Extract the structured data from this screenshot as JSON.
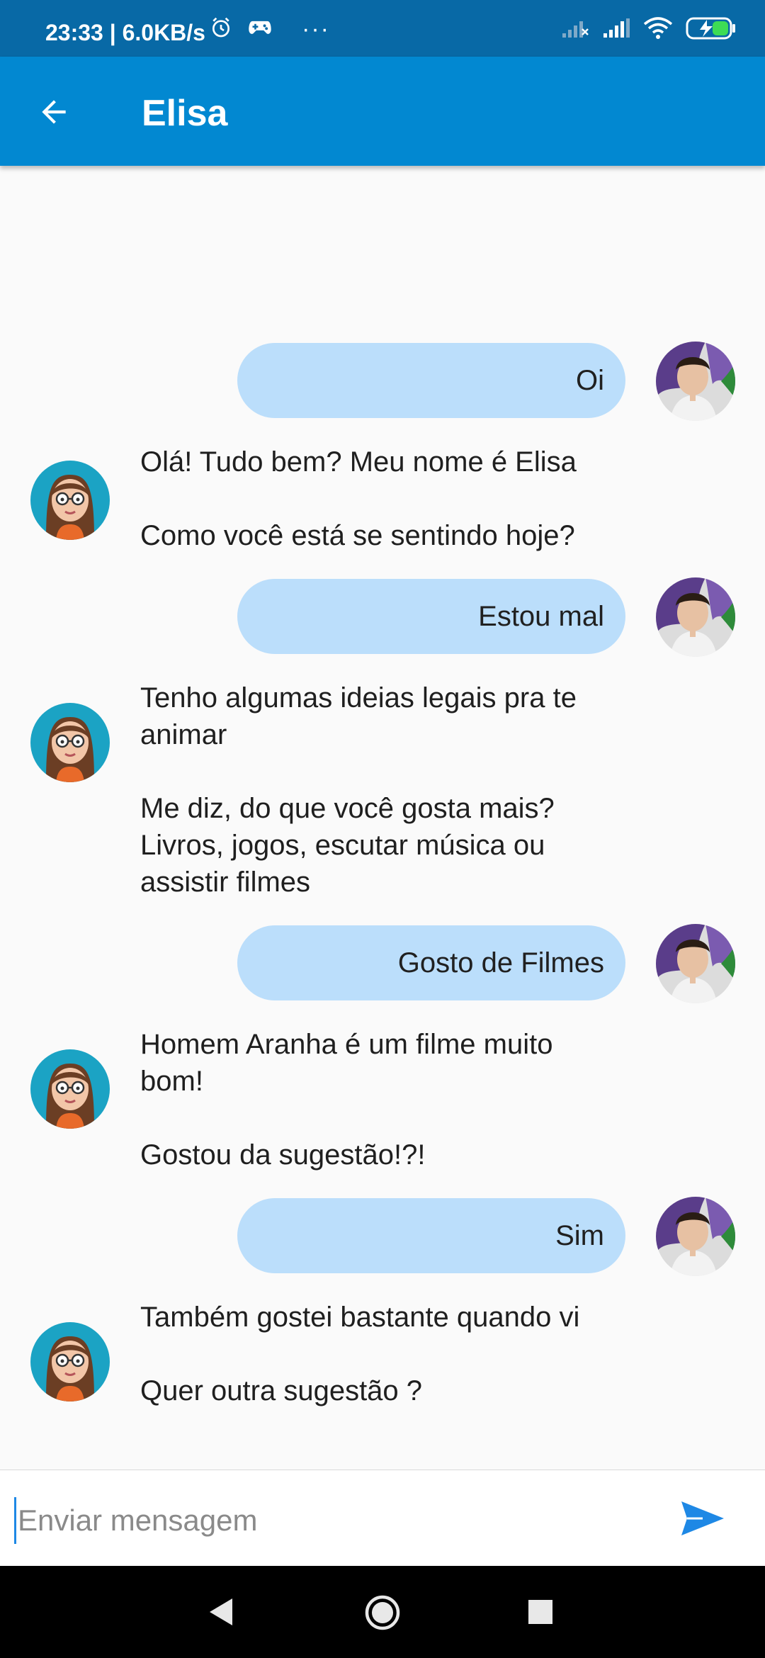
{
  "status_bar": {
    "time_speed": "23:33 | 6.0KB/s",
    "icons": [
      "alarm-icon",
      "game-controller-icon",
      "more-dots-icon",
      "signal-no-sim-icon",
      "signal-icon",
      "wifi-icon",
      "battery-charging-icon"
    ]
  },
  "app_bar": {
    "title": "Elisa",
    "back_icon": "arrow-back-icon"
  },
  "colors": {
    "status_bar": "#0869a6",
    "app_bar": "#0288d1",
    "user_bubble": "#bbdefb",
    "send_icon": "#1e88e5",
    "battery_accent": "#3ddc55"
  },
  "messages": [
    {
      "sender": "user",
      "text": "Oi"
    },
    {
      "sender": "bot",
      "paragraphs": [
        "Olá! Tudo bem? Meu nome é Elisa",
        "Como você está se sentindo hoje?"
      ]
    },
    {
      "sender": "user",
      "text": "Estou mal"
    },
    {
      "sender": "bot",
      "paragraphs": [
        "Tenho algumas ideias legais pra te animar",
        "Me diz, do que você gosta mais? Livros, jogos, escutar música ou assistir filmes"
      ]
    },
    {
      "sender": "user",
      "text": "Gosto de Filmes"
    },
    {
      "sender": "bot",
      "paragraphs": [
        "Homem Aranha é um filme muito bom!",
        "Gostou da sugestão!?!"
      ]
    },
    {
      "sender": "user",
      "text": "Sim"
    },
    {
      "sender": "bot",
      "paragraphs": [
        "Também gostei bastante quando vi",
        "Quer outra sugestão ?"
      ]
    }
  ],
  "composer": {
    "placeholder": "Enviar mensagem",
    "value": "",
    "send_icon": "send-icon"
  },
  "nav_bar": {
    "icons": [
      "nav-back-icon",
      "nav-home-icon",
      "nav-recent-icon"
    ]
  }
}
